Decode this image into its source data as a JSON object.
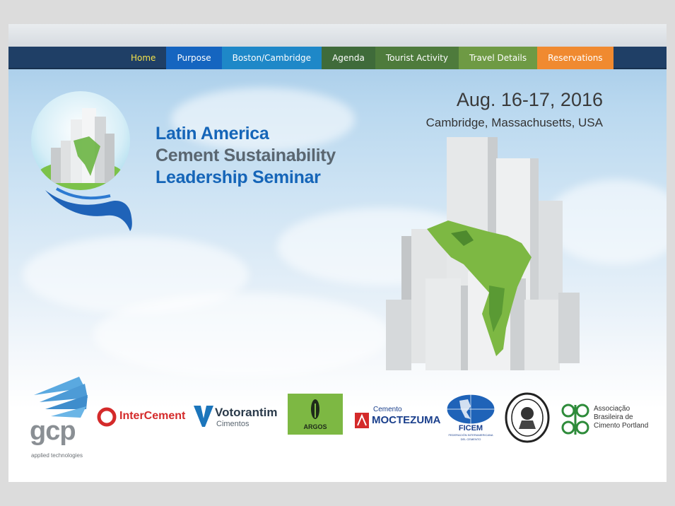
{
  "nav": {
    "items": [
      {
        "label": "Home",
        "active": true
      },
      {
        "label": "Purpose"
      },
      {
        "label": "Boston/Cambridge"
      },
      {
        "label": "Agenda"
      },
      {
        "label": "Tourist Activity"
      },
      {
        "label": "Travel Details"
      },
      {
        "label": "Reservations"
      }
    ]
  },
  "event": {
    "date": "Aug. 16-17, 2016",
    "location": "Cambridge, Massachusetts, USA"
  },
  "title": {
    "line1": "Latin America",
    "line2": "Cement Sustainability",
    "line3": "Leadership Seminar"
  },
  "sponsors": {
    "gcp": {
      "name": "gcp",
      "tagline": "applied technologies"
    },
    "intercement": {
      "name": "InterCement"
    },
    "votorantim": {
      "name": "Votorantim",
      "sub": "Cimentos"
    },
    "argos": {
      "name": "ARGOS"
    },
    "moctezuma": {
      "top": "Cemento",
      "name": "MOCTEZUMA"
    },
    "ficem": {
      "name": "FICEM",
      "sub1": "FEDERACIÓN INTERAMERICANA",
      "sub2": "DEL CEMENTO"
    },
    "abcp": {
      "line1": "Associação",
      "line2": "Brasileira de",
      "line3": "Cimento Portland"
    }
  },
  "colors": {
    "nav_bg": "#1f3f66",
    "home_text": "#f4e24a",
    "purpose": "#1565c0",
    "boston": "#1e88c8",
    "agenda": "#3f6b3a",
    "tourist": "#4e7b3c",
    "travel": "#6e9a44",
    "reservations": "#f08a30",
    "title_blue": "#1565b8",
    "title_gray": "#5a6670"
  }
}
